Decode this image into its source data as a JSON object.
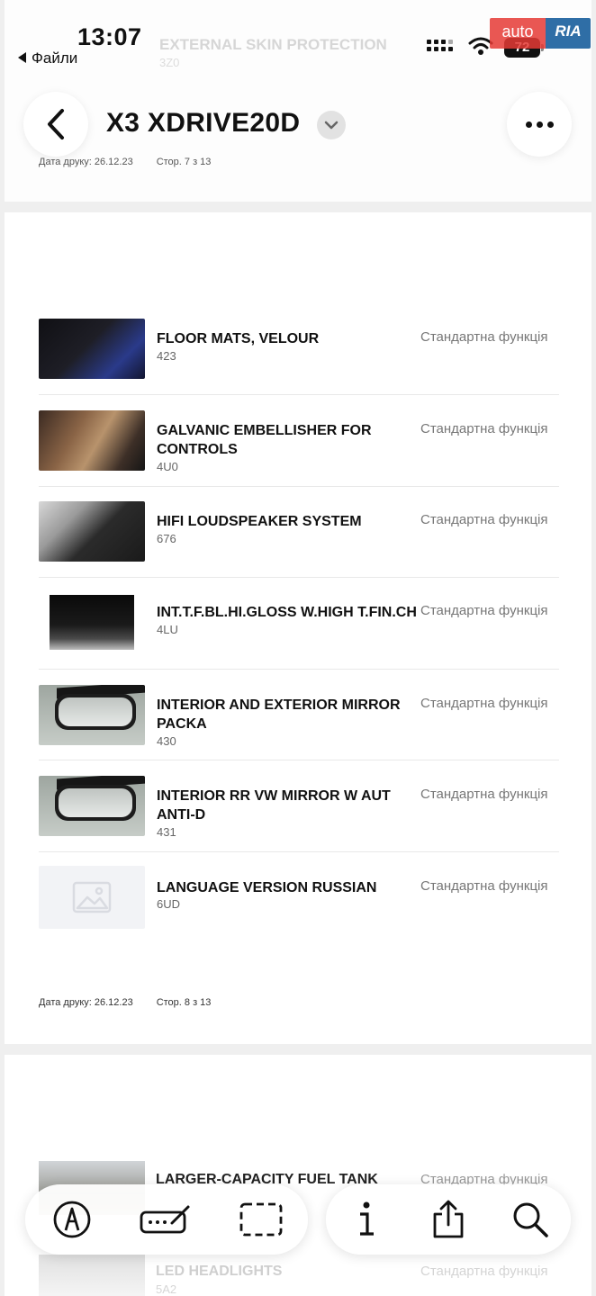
{
  "status_bar": {
    "time": "13:07",
    "back_app_label": "Файли",
    "battery": "72"
  },
  "watermark": {
    "part1": "auto",
    "part2": "RIA"
  },
  "page_prev": {
    "faded_title": "EXTERNAL SKIN PROTECTION",
    "faded_code": "3Z0",
    "footer_date": "Дата друку: 26.12.23",
    "footer_page": "Стор. 7 з 13"
  },
  "header": {
    "title": "X3 XDRIVE20D",
    "icons": [
      "back-chevron-icon",
      "chevron-down-icon",
      "more-dots-icon"
    ]
  },
  "items": [
    {
      "name": "FLOOR MATS, VELOUR",
      "code": "423",
      "status": "Стандартна функція",
      "thumb": "floor"
    },
    {
      "name": "GALVANIC EMBELLISHER FOR CONTROLS",
      "code": "4U0",
      "status": "Стандартна функція",
      "thumb": "galv"
    },
    {
      "name": "HIFI LOUDSPEAKER SYSTEM",
      "code": "676",
      "status": "Стандартна функція",
      "thumb": "hifi"
    },
    {
      "name": "INT.T.F.BL.HI.GLOSS W.HIGH T.FIN.CH",
      "code": "4LU",
      "status": "Стандартна функція",
      "thumb": "gloss"
    },
    {
      "name": "INTERIOR AND EXTERIOR MIRROR PACKA",
      "code": "430",
      "status": "Стандартна функція",
      "thumb": "mirror"
    },
    {
      "name": "INTERIOR RR VW MIRROR W AUT ANTI-D",
      "code": "431",
      "status": "Стандартна функція",
      "thumb": "mirror"
    },
    {
      "name": "LANGUAGE VERSION RUSSIAN",
      "code": "6UD",
      "status": "Стандартна функція",
      "thumb": "empty"
    }
  ],
  "page_footer": {
    "date": "Дата друку: 26.12.23",
    "page": "Стор. 8 з 13"
  },
  "page_next": {
    "item1_name": "LARGER-CAPACITY FUEL TANK",
    "item1_status": "Стандартна функція",
    "item2_name": "LED HEADLIGHTS",
    "item2_code": "5A2",
    "item2_status": "Стандартна функція"
  },
  "toolbar": {
    "left": [
      "markup-pen-icon",
      "signature-icon",
      "selection-rectangle-icon"
    ],
    "right": [
      "info-icon",
      "share-icon",
      "search-icon"
    ]
  }
}
